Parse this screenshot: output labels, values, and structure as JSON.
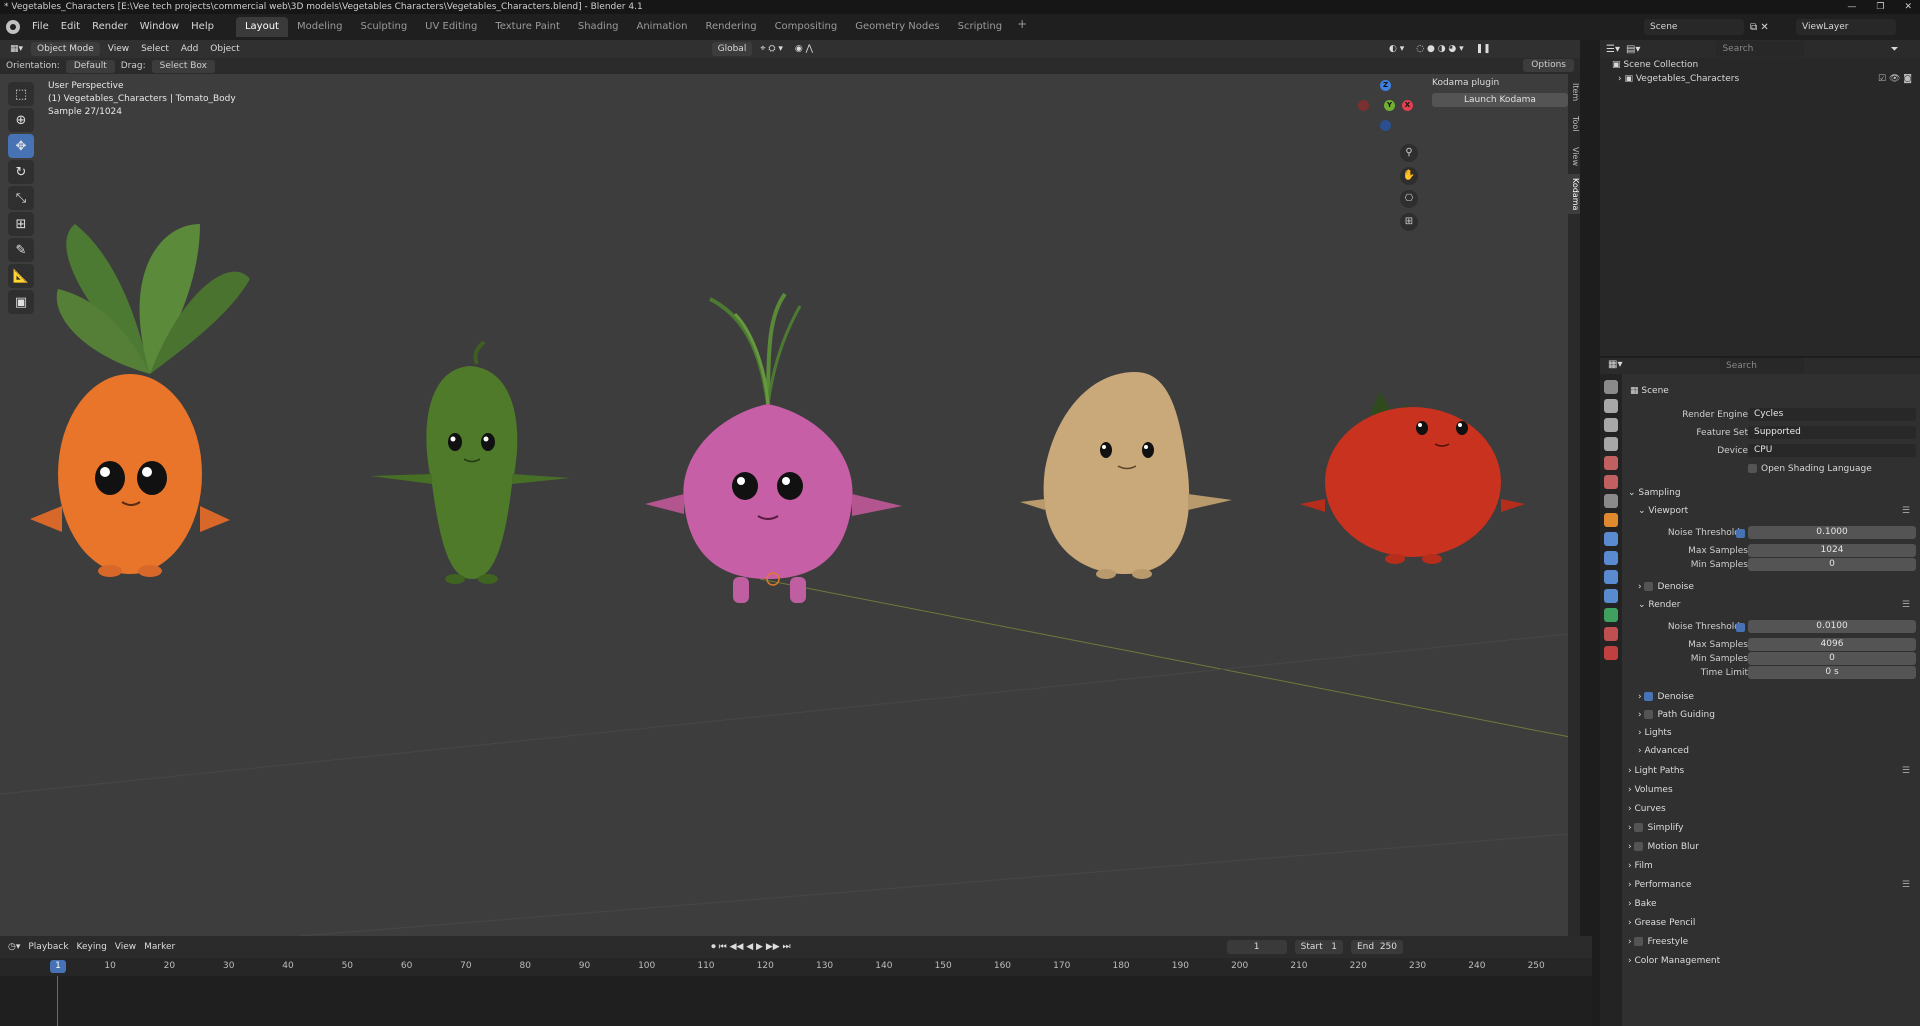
{
  "window": {
    "title": "* Vegetables_Characters [E:\\Vee tech projects\\commercial web\\3D models\\Vegetables Characters\\Vegetables_Characters.blend] - Blender 4.1"
  },
  "menu": [
    "File",
    "Edit",
    "Render",
    "Window",
    "Help"
  ],
  "workspaces": [
    "Layout",
    "Modeling",
    "Sculpting",
    "UV Editing",
    "Texture Paint",
    "Shading",
    "Animation",
    "Rendering",
    "Compositing",
    "Geometry Nodes",
    "Scripting"
  ],
  "active_workspace": "Layout",
  "scene_bar": {
    "scene": "Scene",
    "view_layer": "ViewLayer"
  },
  "viewport_header": {
    "mode": "Object Mode",
    "menus": [
      "View",
      "Select",
      "Add",
      "Object"
    ],
    "transform": "Global",
    "orientation_label": "Orientation:",
    "orientation": "Default",
    "drag_label": "Drag:",
    "drag": "Select Box",
    "options": "Options"
  },
  "viewport_info": {
    "perspective": "User Perspective",
    "object": "(1) Vegetables_Characters | Tomato_Body",
    "sample": "Sample 27/1024"
  },
  "npanel": {
    "header": "Kodama plugin",
    "button": "Launch Kodama",
    "tabs": [
      "Item",
      "Tool",
      "View",
      "Kodama"
    ]
  },
  "gizmo": {
    "x": "X",
    "y": "Y",
    "z": "Z"
  },
  "outliner": {
    "search_placeholder": "Search",
    "root": "Scene Collection",
    "collection": "Vegetables_Characters"
  },
  "properties": {
    "search_placeholder": "Search",
    "context": "Scene",
    "render_engine_label": "Render Engine",
    "render_engine": "Cycles",
    "feature_set_label": "Feature Set",
    "feature_set": "Supported",
    "device_label": "Device",
    "device": "CPU",
    "osl": "Open Shading Language",
    "sampling": "Sampling",
    "viewport": "Viewport",
    "noise_threshold_label": "Noise Threshold",
    "vp_noise": "0.1000",
    "max_samples_label": "Max Samples",
    "vp_max": "1024",
    "min_samples_label": "Min Samples",
    "vp_min": "0",
    "denoise": "Denoise",
    "render": "Render",
    "r_noise": "0.0100",
    "r_max": "4096",
    "r_min": "0",
    "time_limit_label": "Time Limit",
    "r_time": "0 s",
    "path_guiding": "Path Guiding",
    "lights": "Lights",
    "advanced": "Advanced",
    "sections": [
      "Light Paths",
      "Volumes",
      "Curves",
      "Simplify",
      "Motion Blur",
      "Film",
      "Performance",
      "Bake",
      "Grease Pencil",
      "Freestyle",
      "Color Management"
    ]
  },
  "timeline": {
    "menus": [
      "Playback",
      "Keying",
      "View",
      "Marker"
    ],
    "current_frame": "1",
    "start_label": "Start",
    "start": "1",
    "end_label": "End",
    "end": "250",
    "ticks": [
      "10",
      "20",
      "30",
      "40",
      "50",
      "60",
      "70",
      "80",
      "90",
      "100",
      "110",
      "120",
      "130",
      "140",
      "150",
      "160",
      "170",
      "180",
      "190",
      "200",
      "210",
      "220",
      "230",
      "240",
      "250"
    ]
  },
  "colors": {
    "accent": "#4772b3",
    "viewport_bg": "#3d3d3d",
    "carrot": "#e8752a",
    "pepper": "#4e7a2a",
    "onion": "#c65fa6",
    "potato": "#c9a97a",
    "tomato": "#c8321f"
  }
}
